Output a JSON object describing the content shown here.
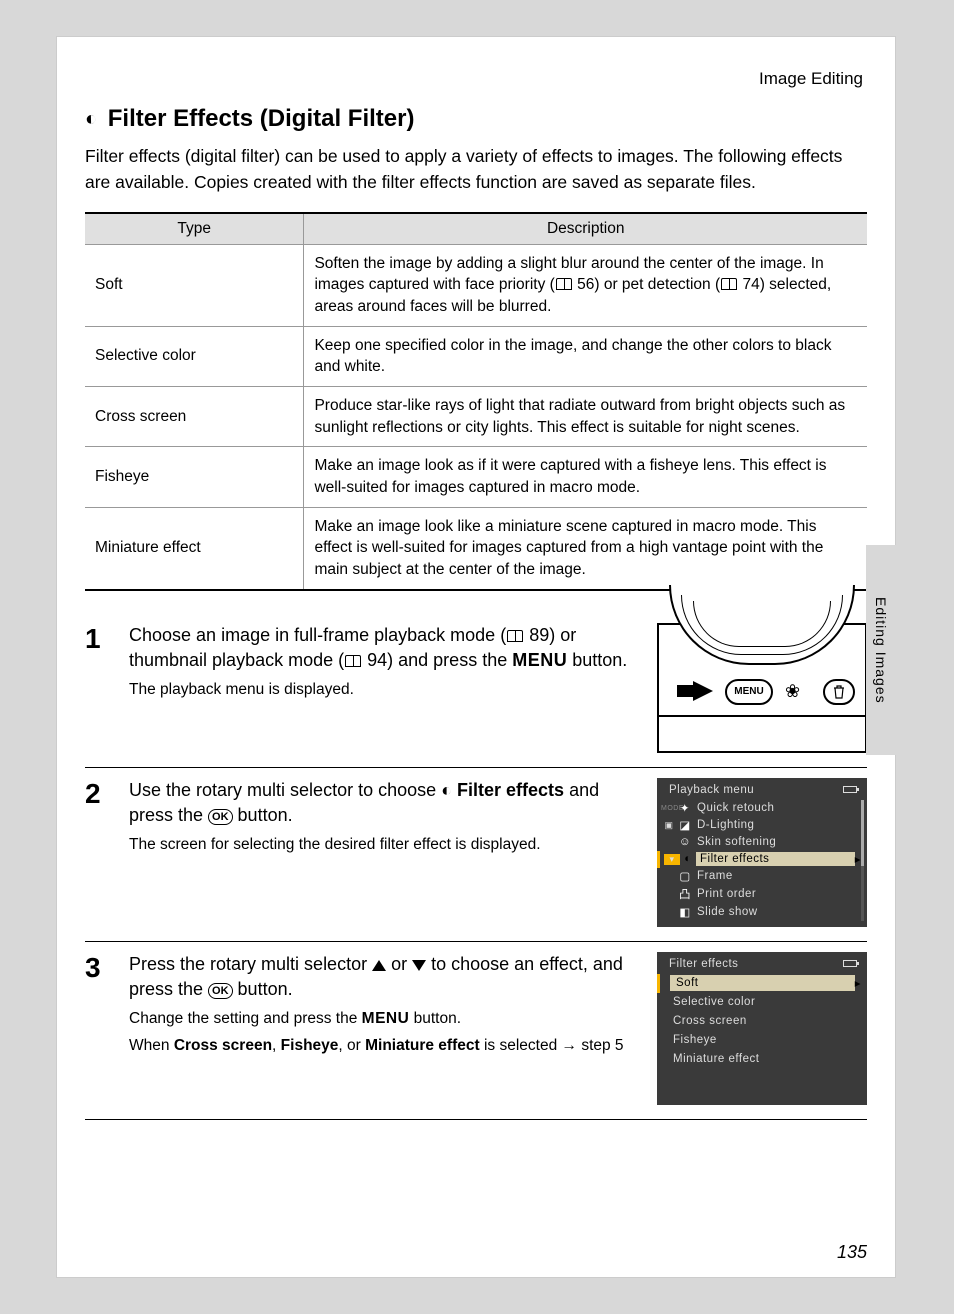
{
  "breadcrumb": "Image Editing",
  "side_tab": "Editing Images",
  "page_number": "135",
  "heading": "Filter Effects (Digital Filter)",
  "intro": "Filter effects (digital filter) can be used to apply a variety of effects to images. The following effects are available. Copies created with the filter effects function are saved as separate files.",
  "table": {
    "head_type": "Type",
    "head_desc": "Description",
    "rows": [
      {
        "type": "Soft",
        "d1": "Soften the image by adding a slight blur around the center of the image. In images captured with face priority (",
        "ref1": " 56) or pet detection (",
        "ref2": " 74) selected, areas around faces will be blurred."
      },
      {
        "type": "Selective color",
        "desc": "Keep one specified color in the image, and change the other colors to black and white."
      },
      {
        "type": "Cross screen",
        "desc": "Produce star-like rays of light that radiate outward from bright objects such as sunlight reflections or city lights. This effect is suitable for night scenes."
      },
      {
        "type": "Fisheye",
        "desc": "Make an image look as if it were captured with a fisheye lens. This effect is well-suited for images captured in macro mode."
      },
      {
        "type": "Miniature effect",
        "desc": "Make an image look like a miniature scene captured in macro mode. This effect is well-suited for images captured from a high vantage point with the main subject at the center of the image."
      }
    ]
  },
  "steps": {
    "s1": {
      "num": "1",
      "t1": "Choose an image in full-frame playback mode (",
      "ref1": " 89) or thumbnail playback mode (",
      "ref2": " 94) and press the ",
      "menu": "MENU",
      "t2": " button.",
      "sub": "The playback menu is displayed.",
      "btn_menu": "MENU"
    },
    "s2": {
      "num": "2",
      "t1": "Use the rotary multi selector to choose ",
      "bold": "Filter effects",
      "t2": " and press the ",
      "ok": "OK",
      "t3": " button.",
      "sub": "The screen for selecting the desired filter effect is displayed.",
      "lcd_title": "Playback menu",
      "items": [
        "Quick retouch",
        "D-Lighting",
        "Skin softening",
        "Filter effects",
        "Frame",
        "Print order",
        "Slide show"
      ]
    },
    "s3": {
      "num": "3",
      "t1": "Press the rotary multi selector ",
      "t2": " or ",
      "t3": " to choose an effect, and press the ",
      "ok": "OK",
      "t4": " button.",
      "sub1a": "Change the setting and press the ",
      "sub1_menu": "MENU",
      "sub1b": " button.",
      "sub2a": "When ",
      "b1": "Cross screen",
      "c1": ", ",
      "b2": "Fisheye",
      "c2": ", or ",
      "b3": "Miniature effect",
      "sub2b": " is selected → step 5",
      "lcd_title": "Filter effects",
      "items": [
        "Soft",
        "Selective color",
        "Cross screen",
        "Fisheye",
        "Miniature effect"
      ]
    }
  }
}
